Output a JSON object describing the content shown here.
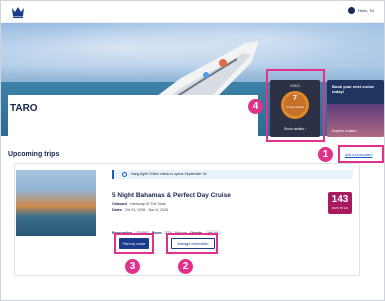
{
  "header": {
    "logo_icon": "crown-anchor-icon",
    "profile_label": "Hello, TA"
  },
  "guest": {
    "name": "TARO"
  },
  "points_card": {
    "tier": "GOLD",
    "value": "7",
    "sub_label": "Cruise Points",
    "link": "Show details ›"
  },
  "book_card": {
    "title": "Book your next cruise today!",
    "link": "Explore cruises ›"
  },
  "trips": {
    "title": "Upcoming trips",
    "add_label": "Add a reservation",
    "notice": "Hang tight! Online check-in opens September 16",
    "trip": {
      "title": "5 Night Bahamas & Perfect Day Cruise",
      "onboard_label": "Onboard",
      "onboard_value": "Harmony Of The Seas",
      "dates_label": "Dates",
      "dates_value": "Oct 31, 2026 - Nov 5, 2026",
      "days_count": "143",
      "days_label": "DAYS TO GO",
      "reservation_label": "Reservation",
      "reservation_value": "1234567",
      "room_label": "Room",
      "room_value": "GTY - Balcony",
      "guests_label": "Guests",
      "guests_value": "ME, AY",
      "plan_label": "Plan my cruise",
      "manage_label": "Manage reservation"
    }
  },
  "markers": [
    "1",
    "2",
    "3",
    "4"
  ],
  "colors": {
    "highlight": "#e0328b",
    "primary": "#1a3a8c",
    "days_badge": "#a8195f",
    "points_ring": "#e08a2a"
  }
}
